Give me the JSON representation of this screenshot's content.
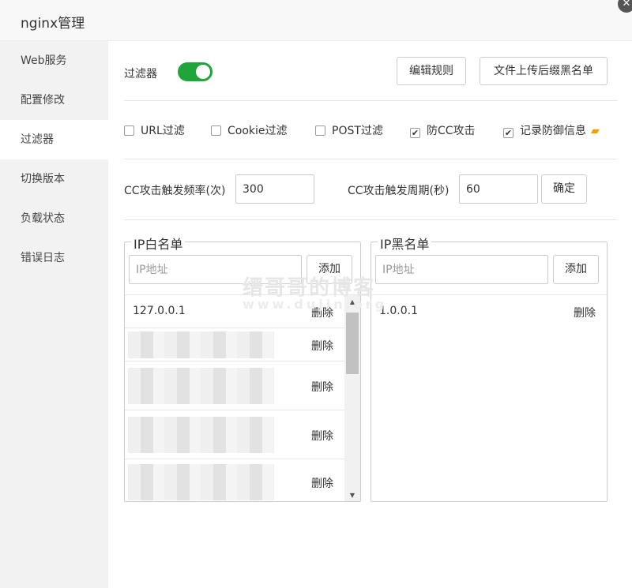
{
  "window": {
    "title": "nginx管理",
    "close_glyph": "✕"
  },
  "sidebar": {
    "items": [
      {
        "label": "Web服务"
      },
      {
        "label": "配置修改"
      },
      {
        "label": "过滤器"
      },
      {
        "label": "切换版本"
      },
      {
        "label": "负载状态"
      },
      {
        "label": "错误日志"
      }
    ],
    "active_index": 2
  },
  "filter": {
    "label": "过滤器",
    "enabled": true,
    "accent_color": "#20a53a",
    "edit_rules_label": "编辑规则",
    "upload_label": "文件上传后缀黑名单"
  },
  "checks": [
    {
      "label": "URL过滤",
      "checked": false
    },
    {
      "label": "Cookie过滤",
      "checked": false
    },
    {
      "label": "POST过滤",
      "checked": false
    },
    {
      "label": "防CC攻击",
      "checked": true
    },
    {
      "label": "记录防御信息",
      "checked": true,
      "icon": "folder-icon"
    }
  ],
  "cc": {
    "freq_label": "CC攻击触发频率(次)",
    "freq_value": "300",
    "period_label": "CC攻击触发周期(秒)",
    "period_value": "60",
    "confirm_label": "确定"
  },
  "whitelist": {
    "legend": "IP白名单",
    "placeholder": "IP地址",
    "add_label": "添加",
    "rows": [
      {
        "ip": "127.0.0.1",
        "del": "删除"
      },
      {
        "ip": "",
        "del": "删除"
      },
      {
        "ip": "",
        "del": "删除"
      },
      {
        "ip": "",
        "del": "删除"
      },
      {
        "ip": "",
        "del": "删除"
      }
    ]
  },
  "blacklist": {
    "legend": "IP黑名单",
    "placeholder": "IP地址",
    "add_label": "添加",
    "rows": [
      {
        "ip": "1.0.0.1",
        "del": "删除"
      }
    ]
  },
  "watermark": {
    "line1": "缙哥哥的博客",
    "line2": "www.dujin.org"
  }
}
